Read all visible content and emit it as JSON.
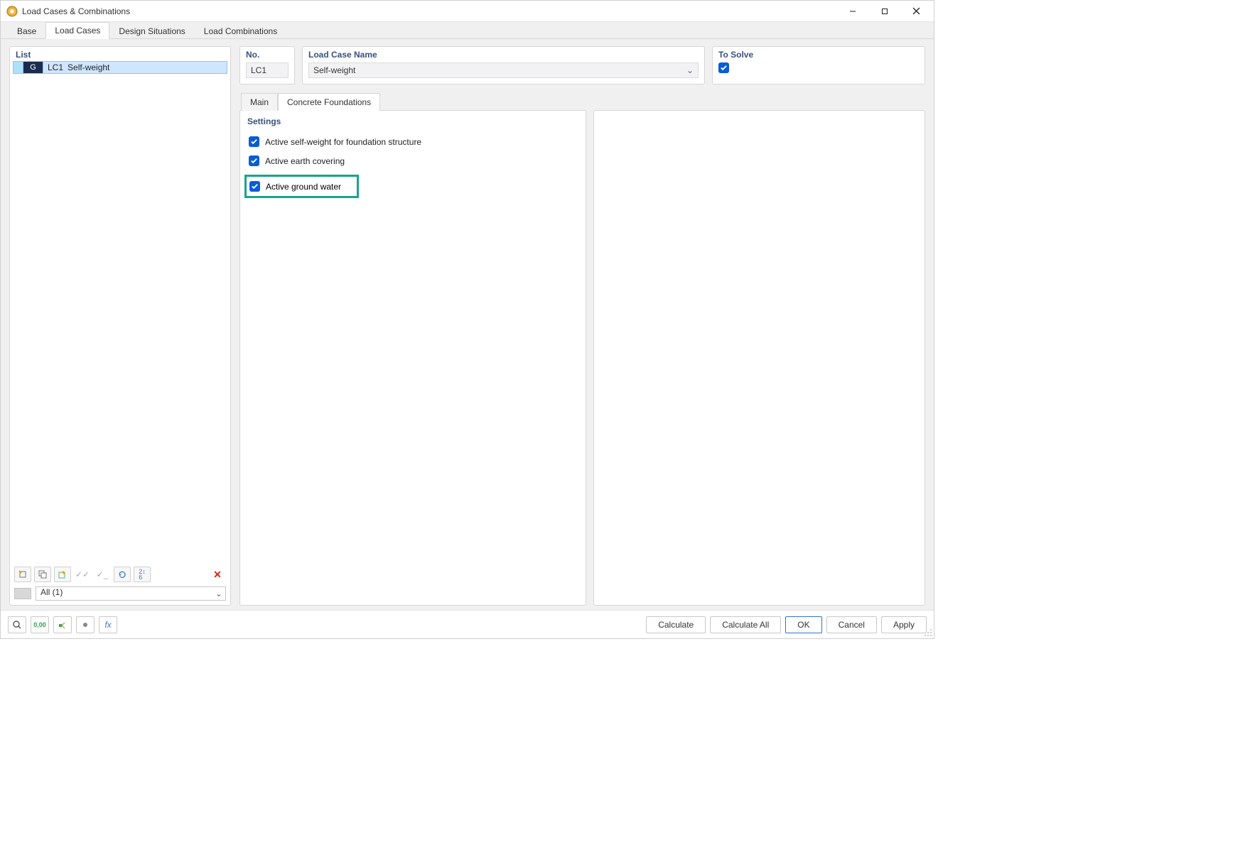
{
  "window": {
    "title": "Load Cases & Combinations"
  },
  "tabs": {
    "base": "Base",
    "load_cases": "Load Cases",
    "design_situations": "Design Situations",
    "load_combinations": "Load Combinations",
    "active": "load_cases"
  },
  "list": {
    "header": "List",
    "items": [
      {
        "badge": "G",
        "code": "LC1",
        "name": "Self-weight"
      }
    ],
    "filter_label": "All (1)"
  },
  "detail": {
    "no_label": "No.",
    "no_value": "LC1",
    "name_label": "Load Case Name",
    "name_value": "Self-weight",
    "solve_label": "To Solve",
    "solve_checked": true
  },
  "inner_tabs": {
    "main": "Main",
    "cf": "Concrete Foundations",
    "active": "cf"
  },
  "settings": {
    "title": "Settings",
    "opts": {
      "selfweight": "Active self-weight for foundation structure",
      "earth": "Active earth covering",
      "groundwater": "Active ground water"
    }
  },
  "footer": {
    "calculate": "Calculate",
    "calculate_all": "Calculate All",
    "ok": "OK",
    "cancel": "Cancel",
    "apply": "Apply"
  },
  "colors": {
    "accent": "#0a5cd7",
    "highlight_border": "#17a589"
  }
}
